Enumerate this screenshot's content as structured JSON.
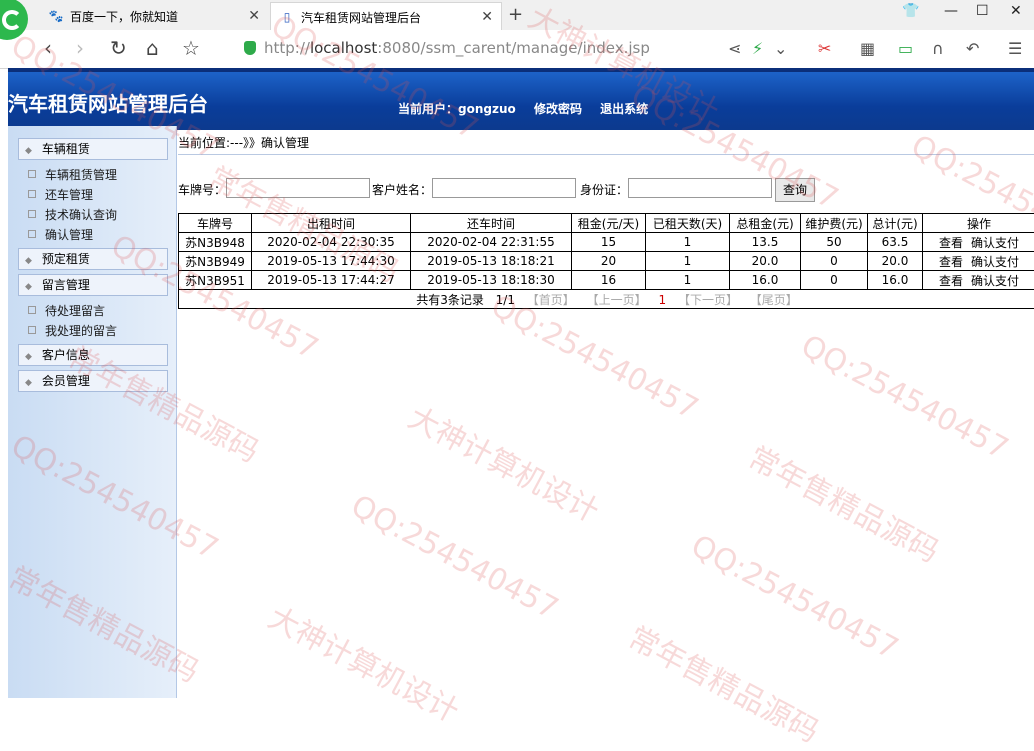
{
  "browser": {
    "tabs": [
      {
        "label": "百度一下，你就知道",
        "icon": "paw-icon"
      },
      {
        "label": "汽车租赁网站管理后台",
        "icon": "page-icon"
      }
    ],
    "url_prefix": "http://",
    "url_host": "localhost",
    "url_rest": ":8080/ssm_carent/manage/index.jsp"
  },
  "header": {
    "title": "汽车租赁网站管理后台",
    "current_user": "当前用户：gongzuo",
    "change_password": "修改密码",
    "logout": "退出系统"
  },
  "sidebar": {
    "groups": [
      {
        "label": "车辆租赁",
        "items": [
          "车辆租赁管理",
          "还车管理",
          "技术确认查询",
          "确认管理"
        ]
      },
      {
        "label": "预定租赁",
        "items": []
      },
      {
        "label": "留言管理",
        "items": [
          "待处理留言",
          "我处理的留言"
        ]
      },
      {
        "label": "客户信息",
        "items": []
      },
      {
        "label": "会员管理",
        "items": []
      }
    ]
  },
  "breadcrumb": "当前位置:---》》确认管理",
  "search": {
    "plate_label": "车牌号：",
    "name_label": "客户姓名：",
    "id_label": "身份证：",
    "button": "查询"
  },
  "table": {
    "headers": [
      "车牌号",
      "出租时间",
      "还车时间",
      "租金(元/天)",
      "已租天数(天)",
      "总租金(元)",
      "维护费(元)",
      "总计(元)",
      "操作"
    ],
    "rows": [
      [
        "苏N3B948",
        "2020-02-04 22:30:35",
        "2020-02-04 22:31:55",
        "15",
        "1",
        "13.5",
        "50",
        "63.5"
      ],
      [
        "苏N3B949",
        "2019-05-13 17:44:30",
        "2019-05-13 18:18:21",
        "20",
        "1",
        "20.0",
        "0",
        "20.0"
      ],
      [
        "苏N3B951",
        "2019-05-13 17:44:27",
        "2019-05-13 18:18:30",
        "16",
        "1",
        "16.0",
        "0",
        "16.0"
      ]
    ],
    "actions": [
      "查看",
      "确认支付"
    ]
  },
  "pager": {
    "summary": "共有3条记录",
    "page": "1/1",
    "first": "【首页】",
    "prev": "【上一页】",
    "current": "1",
    "next": "【下一页】",
    "last": "【尾页】"
  },
  "watermark": {
    "qq": "QQ:254540457",
    "a": "大神计算机设计",
    "b": "常年售精品源码"
  }
}
